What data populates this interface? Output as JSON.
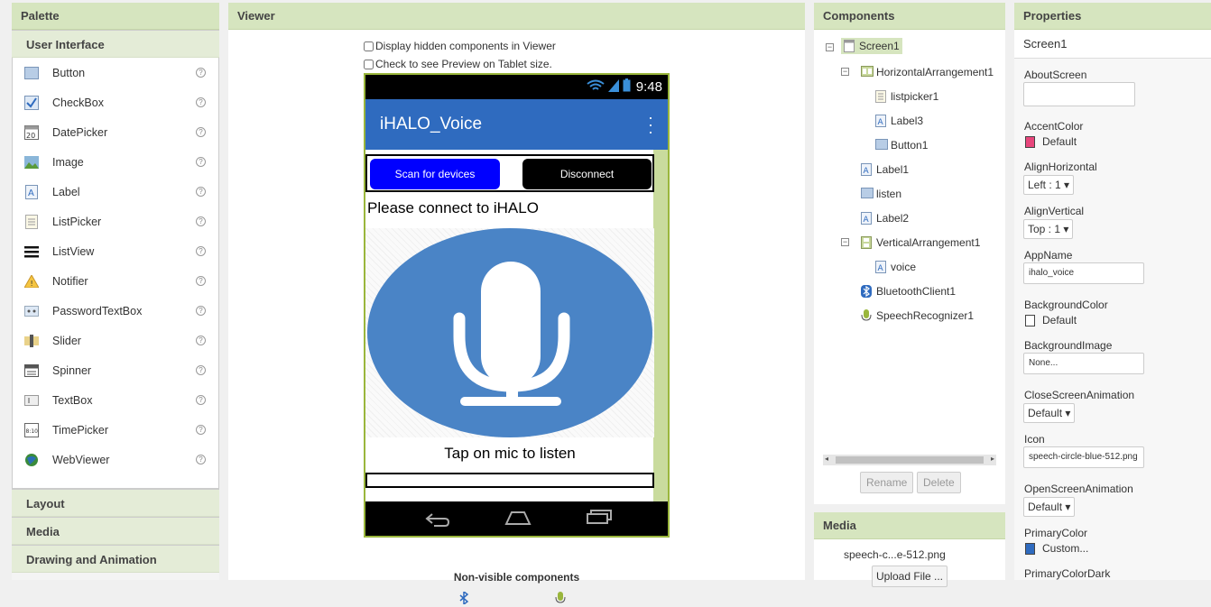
{
  "palette": {
    "title": "Palette",
    "section": "User Interface",
    "items": [
      {
        "label": "Button",
        "icon": "button-icon"
      },
      {
        "label": "CheckBox",
        "icon": "checkbox-icon"
      },
      {
        "label": "DatePicker",
        "icon": "datepicker-icon"
      },
      {
        "label": "Image",
        "icon": "image-icon"
      },
      {
        "label": "Label",
        "icon": "label-icon"
      },
      {
        "label": "ListPicker",
        "icon": "listpicker-icon"
      },
      {
        "label": "ListView",
        "icon": "listview-icon"
      },
      {
        "label": "Notifier",
        "icon": "notifier-icon"
      },
      {
        "label": "PasswordTextBox",
        "icon": "passwordtextbox-icon"
      },
      {
        "label": "Slider",
        "icon": "slider-icon"
      },
      {
        "label": "Spinner",
        "icon": "spinner-icon"
      },
      {
        "label": "TextBox",
        "icon": "textbox-icon"
      },
      {
        "label": "TimePicker",
        "icon": "timepicker-icon"
      },
      {
        "label": "WebViewer",
        "icon": "webviewer-icon"
      }
    ],
    "help": "?",
    "sections": [
      "Layout",
      "Media",
      "Drawing and Animation"
    ]
  },
  "viewer": {
    "title": "Viewer",
    "hidden_label": "Display hidden components in Viewer",
    "tablet_label": "Check to see Preview on Tablet size.",
    "time": "9:48",
    "app_title": "iHALO_Voice",
    "scan_label": "Scan for devices",
    "disconnect_label": "Disconnect",
    "label1": "Please connect to iHALO",
    "label2": "Tap on mic to listen",
    "nonvisible_title": "Non-visible components"
  },
  "components": {
    "title": "Components",
    "tree": [
      "Screen1",
      "HorizontalArrangement1",
      "listpicker1",
      "Label3",
      "Button1",
      "Label1",
      "listen",
      "Label2",
      "VerticalArrangement1",
      "voice",
      "BluetoothClient1",
      "SpeechRecognizer1"
    ],
    "rename": "Rename",
    "delete": "Delete"
  },
  "media": {
    "title": "Media",
    "file": "speech-c...e-512.png",
    "upload": "Upload File ..."
  },
  "properties": {
    "title": "Properties",
    "component": "Screen1",
    "about_label": "AboutScreen",
    "accent_label": "AccentColor",
    "accent_value": "Default",
    "accent_color": "#e8467c",
    "alignh_label": "AlignHorizontal",
    "alignh_value": "Left : 1 ▾",
    "alignv_label": "AlignVertical",
    "alignv_value": "Top : 1 ▾",
    "appname_label": "AppName",
    "appname_value": "ihalo_voice",
    "bgcolor_label": "BackgroundColor",
    "bgcolor_value": "Default",
    "bgimage_label": "BackgroundImage",
    "bgimage_value": "None...",
    "closeanim_label": "CloseScreenAnimation",
    "closeanim_value": "Default ▾",
    "icon_label": "Icon",
    "icon_value": "speech-circle-blue-512.png",
    "openanim_label": "OpenScreenAnimation",
    "openanim_value": "Default ▾",
    "primary_label": "PrimaryColor",
    "primary_value": "Custom...",
    "primary_color": "#2f6bbf",
    "primarydark_label": "PrimaryColorDark"
  }
}
